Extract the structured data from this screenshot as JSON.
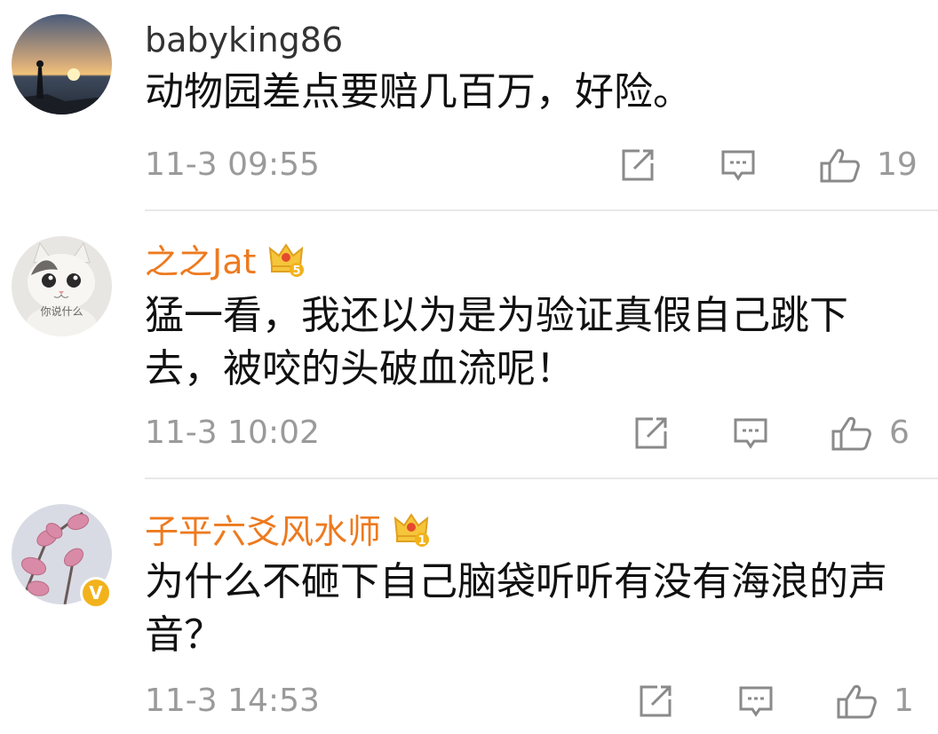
{
  "comments": [
    {
      "username": "babyking86",
      "vip": false,
      "text": "动物园差点要赔几百万，好险。",
      "time": "11-3 09:55",
      "likes": "19"
    },
    {
      "username": "之之Jat",
      "vip": true,
      "crown_level": "5",
      "avatar_caption": "你说什么",
      "text": "猛一看，我还以为是为验证真假自己跳下去，被咬的头破血流呢！",
      "time": "11-3 10:02",
      "likes": "6"
    },
    {
      "username": "子平六爻风水师",
      "vip": true,
      "crown_level": "1",
      "verified_badge": "V",
      "text": "为什么不砸下自己脑袋听听有没有海浪的声音？",
      "time": "11-3 14:53",
      "likes": "1"
    }
  ],
  "icons": {
    "share": "share-icon",
    "reply": "comment-icon",
    "like": "thumbs-up-icon"
  },
  "colors": {
    "vip_name": "#ed7a1f",
    "meta": "#9a9a9a",
    "verified": "#f2b21c",
    "crown": "#f2b21c"
  }
}
